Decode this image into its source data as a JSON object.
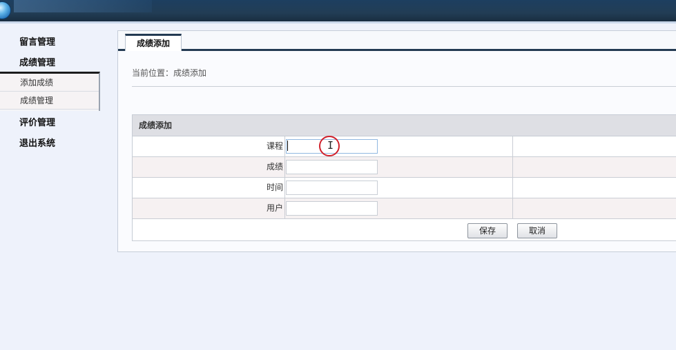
{
  "sidebar": {
    "menus": [
      "留言管理",
      "成绩管理",
      "评价管理",
      "退出系统"
    ],
    "submenu": [
      "添加成绩",
      "成绩管理"
    ]
  },
  "tab": {
    "label": "成绩添加"
  },
  "breadcrumb": "当前位置：成绩添加",
  "form": {
    "title": "成绩添加",
    "fields": [
      {
        "label": "课程",
        "value": ""
      },
      {
        "label": "成绩",
        "value": ""
      },
      {
        "label": "时间",
        "value": ""
      },
      {
        "label": "用户",
        "value": ""
      }
    ],
    "save_label": "保存",
    "cancel_label": "取消"
  },
  "cursor": {
    "glyph": "I"
  }
}
